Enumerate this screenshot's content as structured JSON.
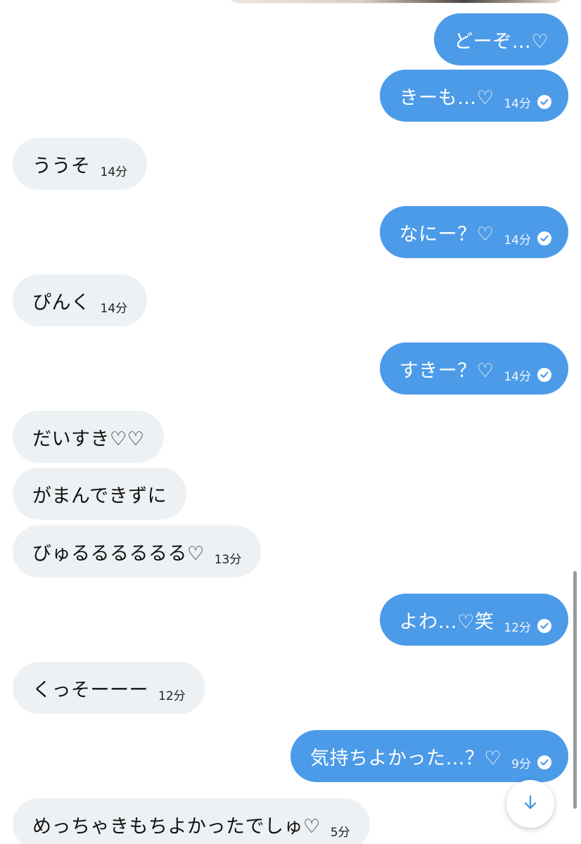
{
  "messages": [
    {
      "text": "どーぞ…♡",
      "time": "",
      "read": false
    },
    {
      "text": "きーも…♡",
      "time": "14分",
      "read": true
    },
    {
      "text": "ううそ",
      "time": "14分",
      "read": false
    },
    {
      "text": "なにー？♡",
      "time": "14分",
      "read": true
    },
    {
      "text": "ぴんく",
      "time": "14分",
      "read": false
    },
    {
      "text": "すきー？♡",
      "time": "14分",
      "read": true
    },
    {
      "text": "だいすき♡♡",
      "time": "",
      "read": false
    },
    {
      "text": "がまんできずに",
      "time": "",
      "read": false
    },
    {
      "text": "びゅるるるるるる♡",
      "time": "13分",
      "read": false
    },
    {
      "text": "よわ…♡笑",
      "time": "12分",
      "read": true
    },
    {
      "text": "くっそーーー",
      "time": "12分",
      "read": false
    },
    {
      "text": "気持ちよかった…？♡",
      "time": "9分",
      "read": true
    },
    {
      "text": "めっちゃきもちよかったでしゅ♡",
      "time": "5分",
      "read": false
    }
  ],
  "icons": {
    "read": "check-circle-icon",
    "scroll": "arrow-down-icon"
  },
  "colors": {
    "sent_bubble": "#4c9be8",
    "received_bubble": "#eef1f3",
    "accent": "#4c9be8"
  }
}
